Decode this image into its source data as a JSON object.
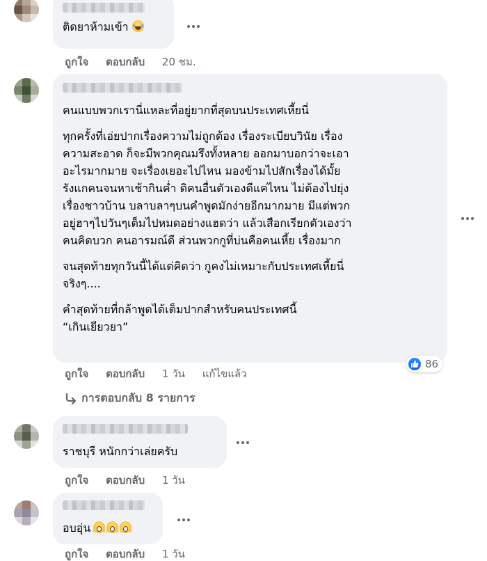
{
  "comments": [
    {
      "text": [
        "ติดยาห้ามเข้า"
      ],
      "emoji": "laughing-tears-emoji",
      "like_label": "ถูกใจ",
      "reply_label": "ตอบกลับ",
      "time": "20 ชม."
    },
    {
      "paragraphs": [
        [
          "คนแบบพวกเรานี่แหละที่อยู่ยากที่สุดบนประเทศเหี้ยนี่"
        ],
        [
          "ทุกครั้งที่เอ่ยปากเรื่องความไม่ถูกต้อง เรื่องระเบียบวินัย เรื่อง",
          "ความสะอาด ก็จะมีพวกคุณมรึงทั้งหลาย ออกมาบอกว่าจะเอา",
          "อะไรมากมาย จะเรื่องเยอะไปไหน มองข้ามไปสักเรื่องได้มั้ย",
          "รังแกคนจนหาเช้ากินค่ำ ดิคนอื่นตัวเองดีแค่ไหน ไม่ต้องไปยุ่ง",
          "เรื่องชาวบ้าน บลาบลาๆบนคำพูดมักง่ายอีกมากมาย มีแต่พวก",
          "อยู่ฮาๆไปวันๆเต็มไปหมดอย่างแฮดว่า แล้วเสือกเรียกตัวเองว่า",
          "คนคิดบวก คนอารมณ์ดี ส่วนพวกกูที่บ่นคือคนเหี้ย เรื่องมาก"
        ],
        [
          "จนสุดท้ายทุกวันนี้ได้แต่คิดว่า กูคงไม่เหมาะกับประเทศเหี้ยนี่",
          "จริงๆ...."
        ],
        [
          "คำสุดท้ายที่กล้าพูดได้เต็มปากสำหรับคนประเทศนี้",
          "“เกินเยียวยา”"
        ]
      ],
      "like_label": "ถูกใจ",
      "reply_label": "ตอบกลับ",
      "time": "1 วัน",
      "edited": "แก้ไขแล้ว",
      "reaction_count": "86",
      "reaction_icon": "like-icon",
      "replies_link": "การตอบกลับ 8 รายการ"
    },
    {
      "text": [
        "ราชบุรี หนักกว่าเล่ยครับ"
      ],
      "like_label": "ถูกใจ",
      "reply_label": "ตอบกลับ",
      "time": "1 วัน"
    },
    {
      "text": [
        "อบอุ่น"
      ],
      "emoji": "screaming-face-emoji",
      "like_label": "ถูกใจ",
      "reply_label": "ตอบกลับ",
      "time": "1 วัน"
    }
  ],
  "colors": {
    "bubble": "#f0f2f5",
    "secondary_text": "#65676b",
    "primary_text": "#050505",
    "like_blue": "#0866ff"
  }
}
